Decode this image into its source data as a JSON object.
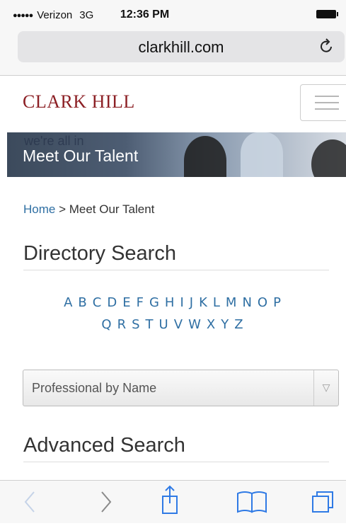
{
  "status_bar": {
    "signal": "●●●●●",
    "carrier": "Verizon",
    "network": "3G",
    "time": "12:36 PM"
  },
  "browser": {
    "url": "clarkhill.com",
    "reload_icon": "reload-icon"
  },
  "site": {
    "logo": "CLARK HILL",
    "menu_icon": "hamburger-menu-icon"
  },
  "banner": {
    "tagline": "we're all in",
    "title": "Meet Our Talent"
  },
  "breadcrumb": {
    "home": "Home",
    "separator": " > ",
    "current": "Meet Our Talent"
  },
  "directory": {
    "title": "Directory Search",
    "letters_row1": [
      "A",
      "B",
      "C",
      "D",
      "E",
      "F",
      "G",
      "H",
      "I",
      "J",
      "K",
      "L",
      "M",
      "N",
      "O",
      "P"
    ],
    "letters_row2": [
      "Q",
      "R",
      "S",
      "T",
      "U",
      "V",
      "W",
      "X",
      "Y",
      "Z"
    ],
    "select_value": "Professional by Name"
  },
  "advanced": {
    "title": "Advanced Search"
  },
  "toolbar": {
    "back": "back-icon",
    "forward": "forward-icon",
    "share": "share-icon",
    "bookmarks": "bookmarks-icon",
    "tabs": "tabs-icon"
  },
  "colors": {
    "brand": "#8c2025",
    "link": "#2f6fa3"
  }
}
